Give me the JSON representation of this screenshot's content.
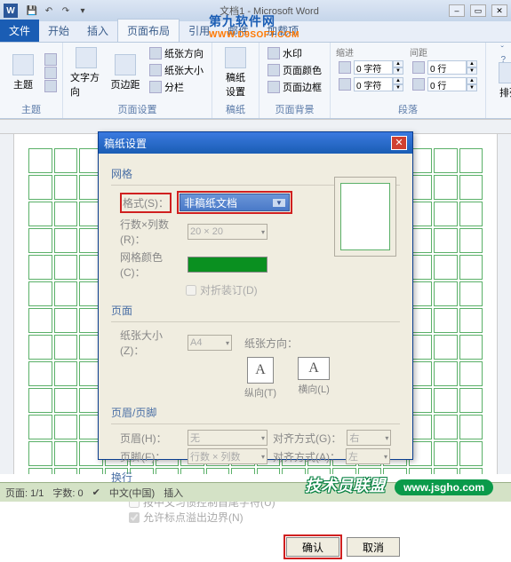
{
  "titlebar": {
    "doc_title": "文档1",
    "app": "Word"
  },
  "watermark": {
    "cn": "第九软件网",
    "url": "WWW.D9SOFT.COM"
  },
  "tabs": {
    "file": "文件",
    "t1": "开始",
    "t2": "插入",
    "t3": "页面布局",
    "t4": "引用",
    "t5": "邮件",
    "t6": "加载项"
  },
  "ribbon": {
    "g1": {
      "theme": "主题",
      "label": "主题"
    },
    "g2": {
      "textdir": "文字方向",
      "margin": "页边距",
      "paperdir": "纸张方向",
      "papersize": "纸张大小",
      "columns": "分栏",
      "label": "页面设置"
    },
    "g3": {
      "gaozhi": "稿纸\n设置",
      "label": "稿纸"
    },
    "g4": {
      "watermark": "水印",
      "pagecolor": "页面颜色",
      "pageborder": "页面边框",
      "label": "页面背景"
    },
    "g5": {
      "indent": "缩进",
      "spacing": "间距",
      "left": "0 字符",
      "right": "0 字符",
      "top": "0 行",
      "bottom": "0 行",
      "label": "段落"
    },
    "g6": {
      "arrange": "排列"
    }
  },
  "dialog": {
    "title": "稿纸设置",
    "sec_grid": "网格",
    "format_label": "格式(S)：",
    "format_value": "非稿纸文档",
    "rowcol_label": "行数×列数(R)：",
    "rowcol_value": "20 × 20",
    "gridcolor_label": "网格颜色(C)：",
    "foldbind": "对折装订(D)",
    "sec_page": "页面",
    "papersize_label": "纸张大小(Z)：",
    "papersize_value": "A4",
    "paperdir_label": "纸张方向：",
    "orient_v": "纵向(T)",
    "orient_h": "横向(L)",
    "sec_hf": "页眉/页脚",
    "header_label": "页眉(H)：",
    "header_value": "无",
    "header_align_label": "对齐方式(G)：",
    "header_align_value": "右",
    "footer_label": "页脚(F)：",
    "footer_value": "行数 × 列数",
    "footer_align_label": "对齐方式(A)：",
    "footer_align_value": "左",
    "sec_wrap": "换行",
    "chk1": "按中文习惯控制首尾字符(U)",
    "chk2": "允许标点溢出边界(N)",
    "ok": "确认",
    "cancel": "取消"
  },
  "status": {
    "page": "页面: 1/1",
    "words": "字数: 0",
    "lang": "中文(中国)",
    "mode": "插入"
  },
  "footer": {
    "cn": "技术员联盟",
    "url": "www.jsgho.com"
  }
}
